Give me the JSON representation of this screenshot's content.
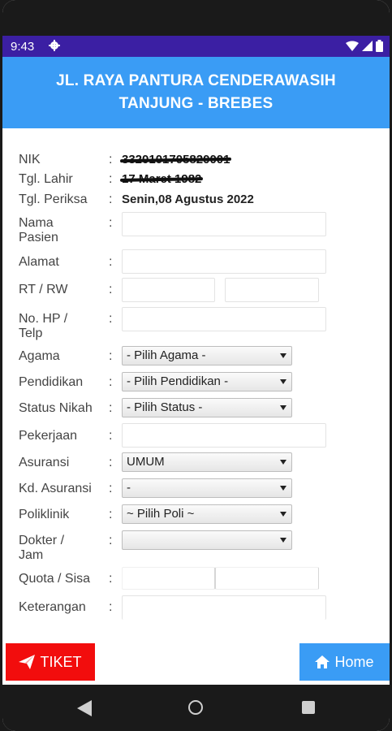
{
  "status_bar": {
    "time": "9:43",
    "icons": [
      "gear-icon",
      "wifi-icon",
      "signal-icon",
      "battery-icon"
    ]
  },
  "header": {
    "line1": "JL. RAYA PANTURA CENDERAWASIH",
    "line2": "TANJUNG - BREBES"
  },
  "form": {
    "colon": ":",
    "nik": {
      "label": "NIK",
      "value": "3320101705820001"
    },
    "tgl_lahir": {
      "label": "Tgl. Lahir",
      "value": "17 Maret 1982"
    },
    "tgl_periksa": {
      "label": "Tgl. Periksa",
      "value": "Senin,08 Agustus 2022"
    },
    "nama_pasien": {
      "label_line1": "Nama",
      "label_line2": "Pasien",
      "value": ""
    },
    "alamat": {
      "label": "Alamat",
      "value": ""
    },
    "rt_rw": {
      "label": "RT / RW",
      "rt_value": "",
      "rw_value": ""
    },
    "no_hp": {
      "label_line1": "No. HP /",
      "label_line2": "Telp",
      "value": ""
    },
    "agama": {
      "label": "Agama",
      "selected": "- Pilih Agama -"
    },
    "pendidikan": {
      "label": "Pendidikan",
      "selected": "- Pilih Pendidikan -"
    },
    "status_nikah": {
      "label": "Status Nikah",
      "selected": "- Pilih Status -"
    },
    "pekerjaan": {
      "label": "Pekerjaan",
      "value": ""
    },
    "asuransi": {
      "label": "Asuransi",
      "selected": "UMUM"
    },
    "kd_asuransi": {
      "label": "Kd. Asuransi",
      "selected": "-"
    },
    "poliklinik": {
      "label": "Poliklinik",
      "selected": "~ Pilih Poli ~"
    },
    "dokter_jam": {
      "label_line1": "Dokter /",
      "label_line2": "Jam",
      "selected": ""
    },
    "quota_sisa": {
      "label": "Quota / Sisa",
      "quota": "",
      "sisa": ""
    },
    "keterangan": {
      "label": "Keterangan",
      "value": ""
    }
  },
  "buttons": {
    "tiket": "TIKET",
    "home": "Home"
  },
  "colors": {
    "status_bar": "#3b1fa3",
    "header": "#3a9cf5",
    "tiket": "#f20d0d",
    "home": "#3a9cf5"
  }
}
